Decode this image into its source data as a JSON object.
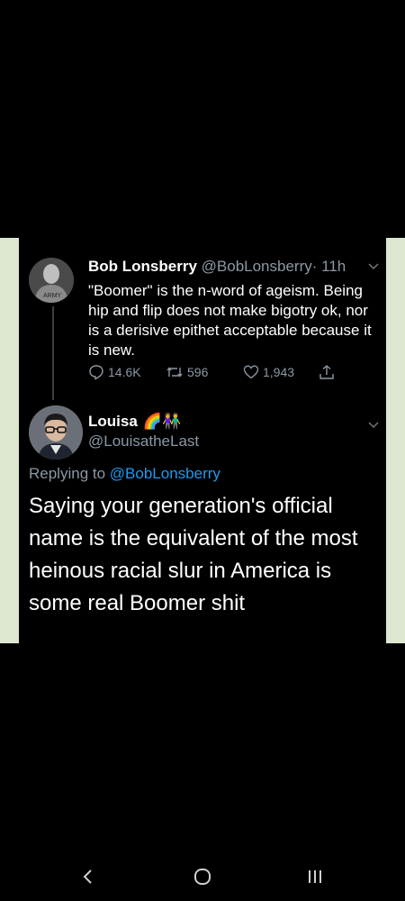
{
  "tweet1": {
    "name": "Bob Lonsberry",
    "handle": "@BobLonsberry",
    "separator": "·",
    "time": "11h",
    "text": "\"Boomer\" is the n-word of ageism. Being hip and flip does not make bigotry ok, nor is a derisive epithet acceptable because it is new.",
    "reply_count": "14.6K",
    "retweet_count": "596",
    "like_count": "1,943",
    "avatar_shirt_text": "ARMY"
  },
  "tweet2": {
    "name": "Louisa",
    "emoji": "🌈👫",
    "handle": "@LouisatheLast",
    "replying_prefix": "Replying to",
    "replying_to": "@BobLonsberry",
    "text": "Saying your generation's official name is the equivalent of the most heinous racial slur in America is some real Boomer shit"
  },
  "icons": {
    "reply": "reply-icon",
    "retweet": "retweet-icon",
    "like": "heart-icon",
    "share": "share-icon",
    "more": "chevron-down-icon",
    "nav_back": "back-icon",
    "nav_home": "home-icon",
    "nav_recents": "recents-icon"
  },
  "colors": {
    "background": "#000000",
    "side_panels": "#dde6cf",
    "secondary_text": "#8b98a5",
    "link": "#1d9bf0"
  }
}
